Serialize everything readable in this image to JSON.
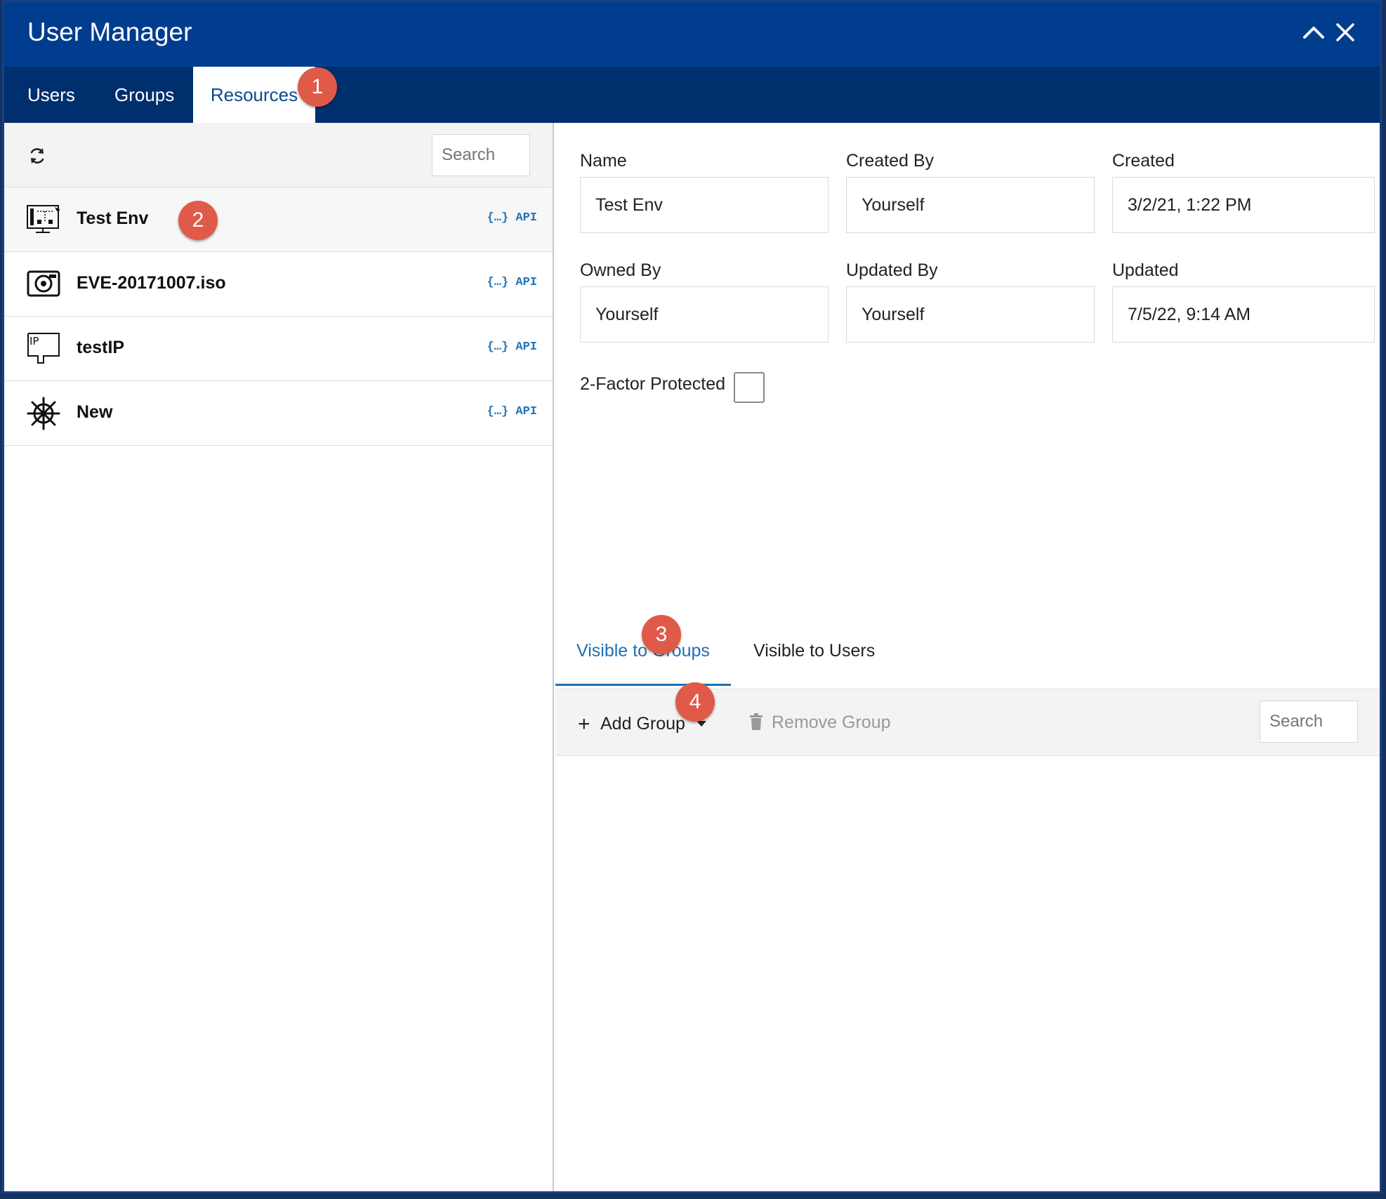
{
  "window": {
    "title": "User Manager",
    "controls": {
      "collapse_icon": "chevron-up-icon",
      "close_icon": "close-icon"
    }
  },
  "tabs": [
    {
      "label": "Users",
      "active": false
    },
    {
      "label": "Groups",
      "active": false
    },
    {
      "label": "Resources",
      "active": true
    }
  ],
  "annotations": [
    "1",
    "2",
    "3",
    "4"
  ],
  "left": {
    "refresh_icon": "refresh-icon",
    "search_placeholder": "Search",
    "items": [
      {
        "name": "Test Env",
        "icon": "environment-icon",
        "api": "{…} API",
        "selected": true
      },
      {
        "name": "EVE-20171007.iso",
        "icon": "disk-image-icon",
        "api": "{…} API",
        "selected": false
      },
      {
        "name": "testIP",
        "icon": "ip-icon",
        "api": "{…} API",
        "selected": false
      },
      {
        "name": "New",
        "icon": "helm-icon",
        "api": "{…} API",
        "selected": false
      }
    ]
  },
  "details": {
    "name": {
      "label": "Name",
      "value": "Test Env"
    },
    "created_by": {
      "label": "Created By",
      "value": "Yourself"
    },
    "created": {
      "label": "Created",
      "value": "3/2/21, 1:22 PM"
    },
    "owned_by": {
      "label": "Owned By",
      "value": "Yourself"
    },
    "updated_by": {
      "label": "Updated By",
      "value": "Yourself"
    },
    "updated": {
      "label": "Updated",
      "value": "7/5/22, 9:14 AM"
    },
    "two_factor": {
      "label": "2-Factor Protected",
      "checked": false
    }
  },
  "visibility": {
    "tabs": [
      {
        "label": "Visible to Groups",
        "active": true
      },
      {
        "label": "Visible to Users",
        "active": false
      }
    ],
    "add_group_label": "Add Group",
    "remove_group_label": "Remove Group",
    "search_placeholder": "Search"
  },
  "colors": {
    "titlebar": "#003d8f",
    "tabbar": "#002f6e",
    "accent": "#1f6fb5",
    "badge": "#e05a4a"
  }
}
